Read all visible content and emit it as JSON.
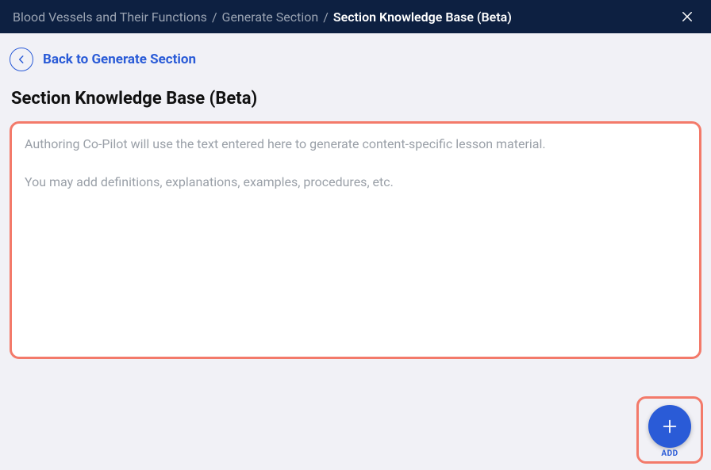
{
  "header": {
    "breadcrumb": {
      "root": "Blood Vessels and Their Functions",
      "mid": "Generate Section",
      "active": "Section Knowledge Base (Beta)",
      "separator": "/"
    }
  },
  "back": {
    "label": "Back to Generate Section"
  },
  "page": {
    "title": "Section Knowledge Base (Beta)"
  },
  "textarea": {
    "value": "",
    "placeholder": "Authoring Co-Pilot will use the text entered here to generate content-specific lesson material.\n\nYou may add definitions, explanations, examples, procedures, etc."
  },
  "fab": {
    "label": "ADD"
  },
  "colors": {
    "header_bg": "#0d2041",
    "accent_blue": "#2a5bd7",
    "highlight_border": "#f37a6a"
  }
}
